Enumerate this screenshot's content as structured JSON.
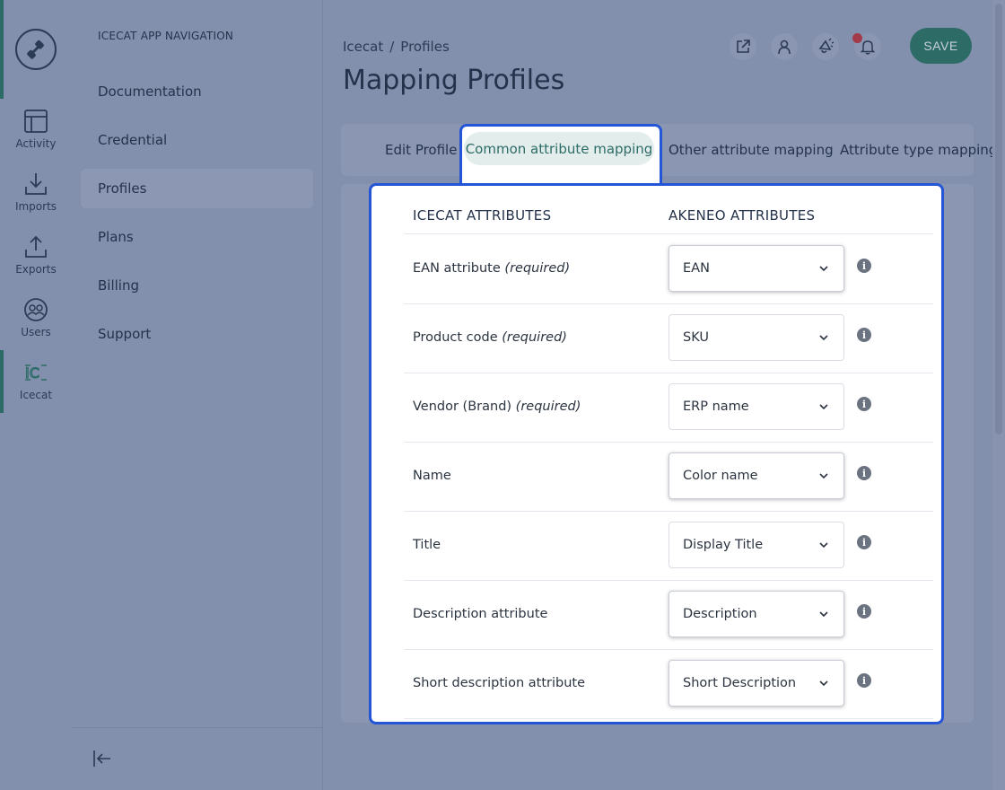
{
  "rail": {
    "items": [
      {
        "label": "Activity",
        "icon": "activity-icon"
      },
      {
        "label": "Imports",
        "icon": "import-icon"
      },
      {
        "label": "Exports",
        "icon": "export-icon"
      },
      {
        "label": "Users",
        "icon": "users-icon"
      },
      {
        "label": "Icecat",
        "icon": "icecat-icon"
      }
    ],
    "accent_color": "#2c6b66"
  },
  "nav": {
    "heading": "ICECAT APP NAVIGATION",
    "items": [
      {
        "label": "Documentation"
      },
      {
        "label": "Credential"
      },
      {
        "label": "Profiles",
        "active": true
      },
      {
        "label": "Plans"
      },
      {
        "label": "Billing"
      },
      {
        "label": "Support"
      }
    ]
  },
  "breadcrumb": {
    "parent": "Icecat",
    "separator": "/",
    "current": "Profiles"
  },
  "page_title": "Mapping Profiles",
  "header": {
    "save_label": "SAVE"
  },
  "tabs": [
    {
      "label": "Edit Profile"
    },
    {
      "label": "Common attribute mapping",
      "active": true
    },
    {
      "label": "Other attribute mapping"
    },
    {
      "label": "Attribute type mapping"
    }
  ],
  "table": {
    "col_icecat": "ICECAT ATTRIBUTES",
    "col_akeneo": "AKENEO ATTRIBUTES",
    "required_tag": "(required)",
    "rows": [
      {
        "label": "EAN attribute",
        "required": "(required)",
        "value": "EAN"
      },
      {
        "label": "Product code",
        "required": "(required)",
        "value": "SKU"
      },
      {
        "label": "Vendor (Brand)",
        "required": "(required)",
        "value": "ERP name"
      },
      {
        "label": "Name",
        "value": "Color name"
      },
      {
        "label": "Title",
        "value": "Display Title"
      },
      {
        "label": "Description attribute",
        "value": "Description"
      },
      {
        "label": "Short description attribute",
        "value": "Short Description"
      }
    ]
  },
  "colors": {
    "highlight": "#2455d6",
    "brand": "#2c6b66",
    "active_tab_text": "#2c6b66"
  }
}
